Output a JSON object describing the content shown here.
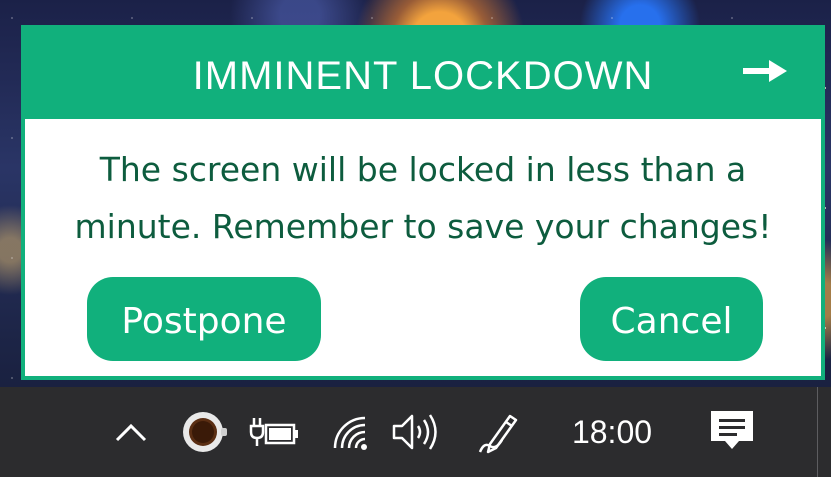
{
  "dialog": {
    "title": "IMMINENT LOCKDOWN",
    "message_line1": "The screen will be locked in less than a",
    "message_line2": "minute. Remember to save your changes!",
    "postpone_label": "Postpone",
    "cancel_label": "Cancel",
    "close_icon": "arrow-right-icon",
    "accent_color": "#11b07c",
    "text_color": "#0d5c3e"
  },
  "taskbar": {
    "clock": "18:00",
    "icons": [
      "chevron-up-icon",
      "coffee-cup-icon",
      "battery-charging-icon",
      "wifi-icon",
      "volume-icon",
      "pen-icon",
      "notification-icon"
    ],
    "background_color": "#2c2c2e"
  }
}
